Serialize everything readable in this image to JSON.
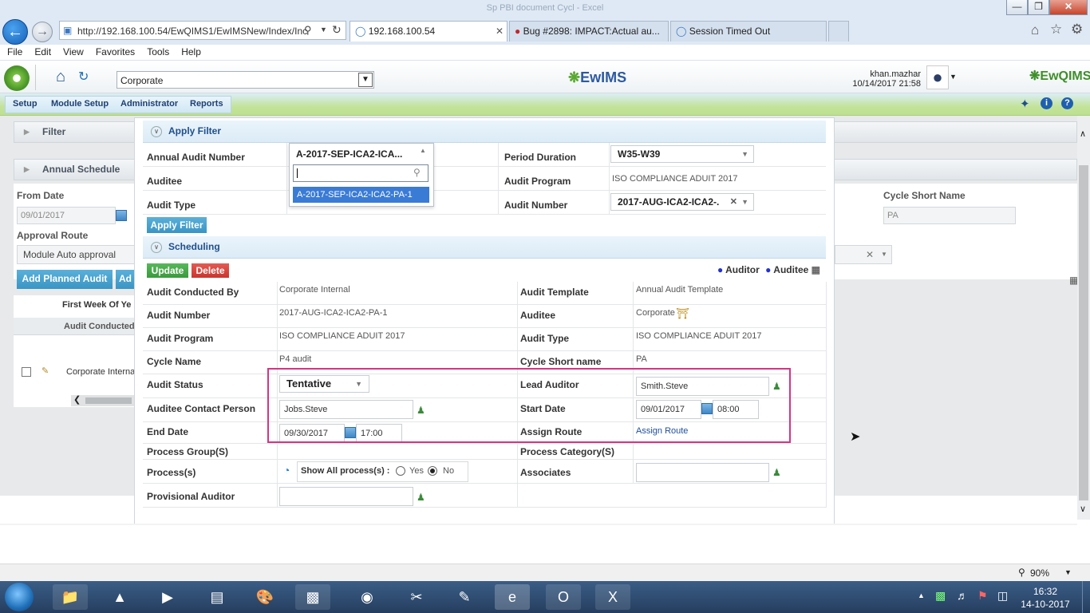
{
  "browser": {
    "window_title": "Sp PBI document Cycl - Excel",
    "address_url": "http://192.168.100.54/EwQIMS1/EwIMSNew/Index/Inc",
    "tabs": [
      {
        "label": "192.168.100.54"
      },
      {
        "label": "Bug #2898: IMPACT:Actual au..."
      },
      {
        "label": "Session Timed Out"
      }
    ],
    "menu": [
      "File",
      "Edit",
      "View",
      "Favorites",
      "Tools",
      "Help"
    ],
    "zoom": "90%"
  },
  "app": {
    "location_select": "Corporate",
    "logo_center": "EwIMS",
    "logo_right": "EwQIMS",
    "user": "khan.mazhar",
    "datetime": "10/14/2017 21:58",
    "modules": [
      "Setup",
      "Module Setup",
      "Administrator",
      "Reports"
    ]
  },
  "background": {
    "filter_title": "Filter",
    "annual_schedule_title": "Annual Schedule",
    "from_date_label": "From Date",
    "from_date_value": "09/01/2017",
    "cycle_short_name_label": "Cycle Short Name",
    "cycle_short_name_value": "PA",
    "approval_route_label": "Approval Route",
    "approval_route_value": "Module Auto approval",
    "add_planned_audit": "Add Planned Audit",
    "add_btn_partial": "Ad",
    "first_week_partial": "First Week Of Ye",
    "grid_header_partial": "Audit Conducted",
    "grid_row_partial": "Corporate Interna"
  },
  "apply_filter": {
    "title": "Apply Filter",
    "annual_audit_number_label": "Annual Audit Number",
    "annual_audit_number_value": "A-2017-SEP-ICA2-ICA...",
    "dropdown_option": "A-2017-SEP-ICA2-ICA2-PA-1",
    "auditee_label": "Auditee",
    "audit_type_label": "Audit Type",
    "period_duration_label": "Period Duration",
    "period_duration_value": "W35-W39",
    "audit_program_label": "Audit Program",
    "audit_program_value": "ISO COMPLIANCE ADUIT 2017",
    "audit_number_label": "Audit Number",
    "audit_number_value": "2017-AUG-ICA2-ICA2-.",
    "apply_button": "Apply Filter"
  },
  "scheduling": {
    "title": "Scheduling",
    "update_button": "Update",
    "delete_button": "Delete",
    "legend_auditor": "Auditor",
    "legend_auditee": "Auditee",
    "audit_conducted_by_label": "Audit Conducted By",
    "audit_conducted_by_value": "Corporate Internal",
    "audit_template_label": "Audit Template",
    "audit_template_value": "Annual Audit Template",
    "audit_number_label": "Audit Number",
    "audit_number_value": "2017-AUG-ICA2-ICA2-PA-1",
    "auditee_label": "Auditee",
    "auditee_value": "Corporate",
    "audit_program_label": "Audit Program",
    "audit_program_value": "ISO COMPLIANCE ADUIT 2017",
    "audit_type_label": "Audit Type",
    "audit_type_value": "ISO COMPLIANCE ADUIT 2017",
    "cycle_name_label": "Cycle Name",
    "cycle_name_value": "P4 audit",
    "cycle_short_name_label": "Cycle Short name",
    "cycle_short_name_value": "PA",
    "audit_status_label": "Audit Status",
    "audit_status_value": "Tentative",
    "lead_auditor_label": "Lead Auditor",
    "lead_auditor_value": "Smith.Steve",
    "auditee_contact_label": "Auditee Contact Person",
    "auditee_contact_value": "Jobs.Steve",
    "start_date_label": "Start Date",
    "start_date_value": "09/01/2017",
    "start_time_value": "08:00",
    "end_date_label": "End Date",
    "end_date_value": "09/30/2017",
    "end_time_value": "17:00",
    "assign_route_label": "Assign Route",
    "assign_route_link": "Assign Route",
    "process_group_label": "Process Group(S)",
    "process_category_label": "Process Category(S)",
    "process_label": "Process(s)",
    "show_all_label": "Show All process(s) :",
    "yes_label": "Yes",
    "no_label": "No",
    "associates_label": "Associates",
    "provisional_auditor_label": "Provisional Auditor"
  },
  "taskbar": {
    "time": "16:32",
    "date": "14-10-2017"
  },
  "colors": {
    "highlight_box": "#d63384",
    "module_bar": "#c4e39b",
    "header_blue": "#1f4f8a"
  }
}
